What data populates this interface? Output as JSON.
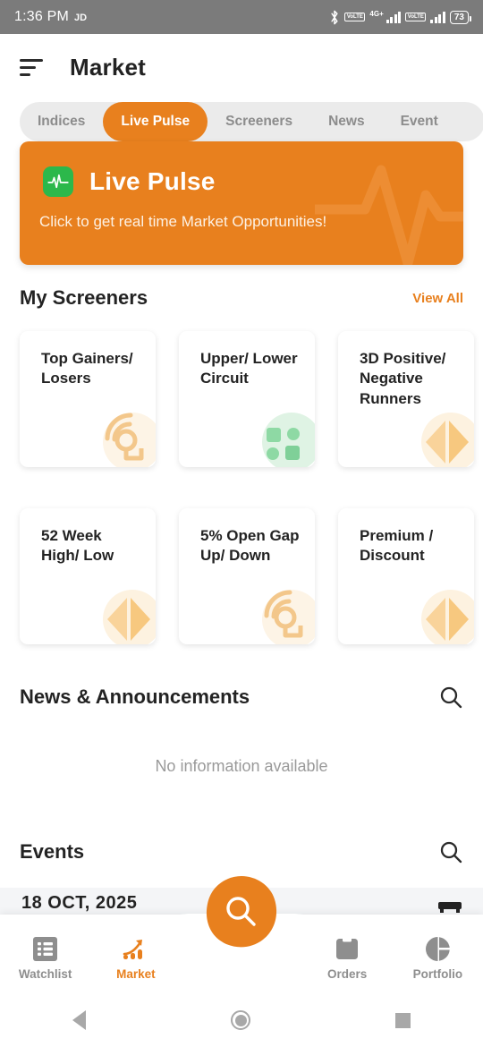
{
  "statusbar": {
    "time": "1:36 PM",
    "carrier": "JD",
    "bluetooth_icon": "bluetooth-icon",
    "volte_label_1": "VoLTE",
    "network_type": "4G+",
    "volte_label_2": "VoLTE",
    "battery_level": "73"
  },
  "header": {
    "menu_icon": "hamburger-menu-icon",
    "title": "Market"
  },
  "tabs": [
    {
      "label": "Indices",
      "active": false
    },
    {
      "label": "Live Pulse",
      "active": true
    },
    {
      "label": "Screeners",
      "active": false
    },
    {
      "label": "News",
      "active": false
    },
    {
      "label": "Event",
      "active": false
    }
  ],
  "banner": {
    "icon": "pulse-wave-icon",
    "title": "Live Pulse",
    "subtitle": "Click to get real time Market Opportunities!",
    "bg_color": "#e8801e",
    "icon_bg_color": "#2cb84b"
  },
  "screeners": {
    "title": "My Screeners",
    "view_all_label": "View All",
    "accent_color": "#e8801e",
    "cards": [
      {
        "label": "Top Gainers/ Losers",
        "icon": "radar-signal-icon",
        "icon_color": "#f5c78a"
      },
      {
        "label": "Upper/ Lower Circuit",
        "icon": "grid-squares-icon",
        "icon_color": "#8ed9a4"
      },
      {
        "label": "3D Positive/ Negative Runners",
        "icon": "bowtie-arrows-icon",
        "icon_color": "#f7cf96"
      },
      {
        "label": "52 Week High/ Low",
        "icon": "bowtie-arrows-icon",
        "icon_color": "#f7cf96"
      },
      {
        "label": "5% Open Gap Up/ Down",
        "icon": "radar-signal-icon",
        "icon_color": "#f5c78a"
      },
      {
        "label": "Premium / Discount",
        "icon": "bowtie-arrows-icon",
        "icon_color": "#f7cf96"
      }
    ]
  },
  "news": {
    "title": "News & Announcements",
    "search_icon": "search-icon",
    "empty_message": "No information available"
  },
  "events": {
    "title": "Events",
    "search_icon": "search-icon",
    "date": "18 OCT, 2025",
    "calendar_icon": "calendar-icon"
  },
  "fab": {
    "icon": "search-icon",
    "color": "#e8801e"
  },
  "bottomnav": [
    {
      "label": "Watchlist",
      "icon": "list-grid-icon",
      "active": false
    },
    {
      "label": "Market",
      "icon": "trending-up-chart-icon",
      "active": true
    },
    {
      "label": "Orders",
      "icon": "folder-book-icon",
      "active": false
    },
    {
      "label": "Portfolio",
      "icon": "pie-chart-icon",
      "active": false
    }
  ],
  "sysnav": {
    "back": "back-triangle-icon",
    "home": "home-circle-icon",
    "recents": "recents-square-icon"
  }
}
